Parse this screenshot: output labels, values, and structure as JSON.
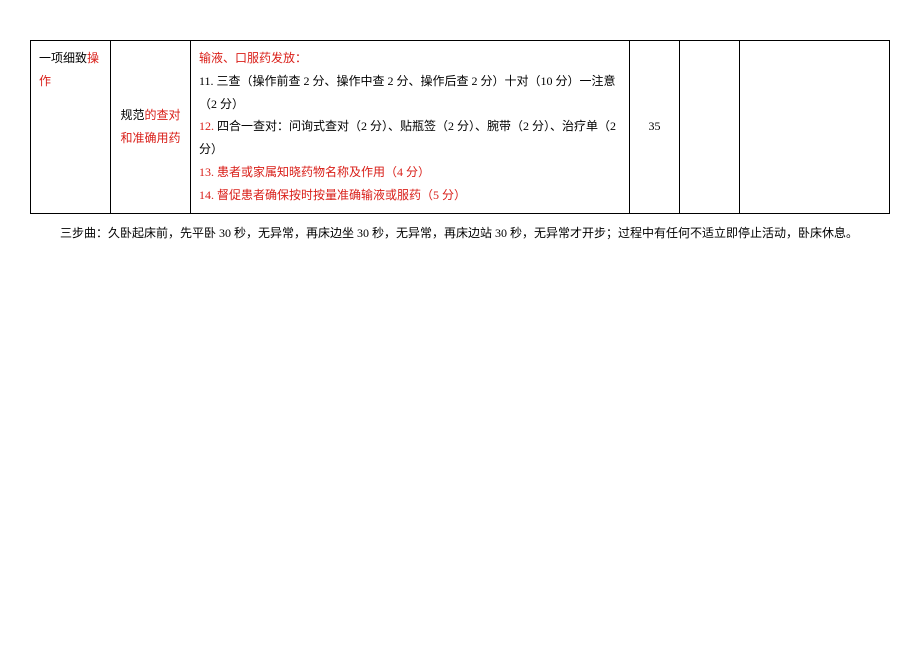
{
  "table": {
    "row1": {
      "col1_prefix": "一项细致",
      "col1_red": "操作",
      "col2_prefix": "规范",
      "col2_red": "的查对和准确用药",
      "content_red_1": "输液、口服药发放：",
      "content_black_1": "11. 三查（操作前查 2 分、操作中查 2 分、操作后查 2 分）十对（10 分）一注意（2 分）",
      "content_red_2a": "12.",
      "content_black_2": " 四合一查对：问询式查对（2 分）、贴瓶签（2 分）、腕带（2 分）、治疗单（2 分）",
      "content_red_3": "13. 患者或家属知晓药物名称及作用（4 分）",
      "content_red_4": "14. 督促患者确保按时按量准确输液或服药（5 分）",
      "score": "35"
    }
  },
  "footnote": "三步曲：久卧起床前，先平卧 30 秒，无异常，再床边坐 30 秒，无异常，再床边站 30 秒，无异常才开步；过程中有任何不适立即停止活动，卧床休息。"
}
